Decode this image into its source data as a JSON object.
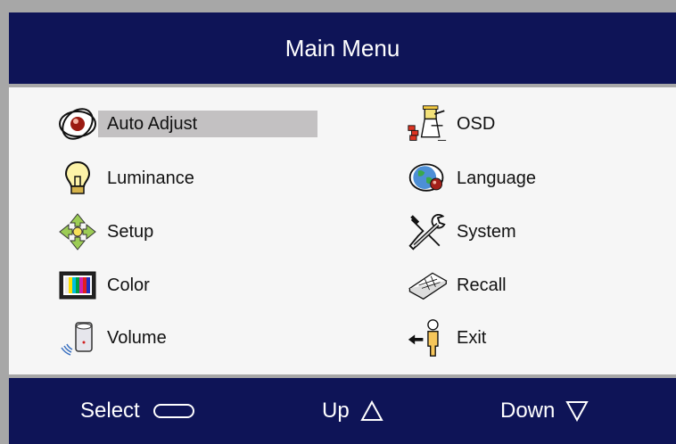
{
  "header": {
    "title": "Main Menu"
  },
  "menu": {
    "left": [
      {
        "label": "Auto Adjust",
        "icon": "eye-icon",
        "selected": true
      },
      {
        "label": "Luminance",
        "icon": "light-bulb-icon"
      },
      {
        "label": "Setup",
        "icon": "arrows-icon"
      },
      {
        "label": "Color",
        "icon": "color-bars-icon"
      },
      {
        "label": "Volume",
        "icon": "speaker-icon"
      }
    ],
    "right": [
      {
        "label": "OSD",
        "icon": "osd-person-icon"
      },
      {
        "label": "Language",
        "icon": "globe-icon"
      },
      {
        "label": "System",
        "icon": "wrench-icon"
      },
      {
        "label": "Recall",
        "icon": "keyboard-icon"
      },
      {
        "label": "Exit",
        "icon": "exit-person-icon"
      }
    ]
  },
  "footer": {
    "select_label": "Select",
    "up_label": "Up",
    "down_label": "Down"
  },
  "colors": {
    "bar": "#0e1457",
    "panel": "#f6f6f6",
    "selection": "#c3c1c2",
    "frame": "#a7a7a7"
  }
}
